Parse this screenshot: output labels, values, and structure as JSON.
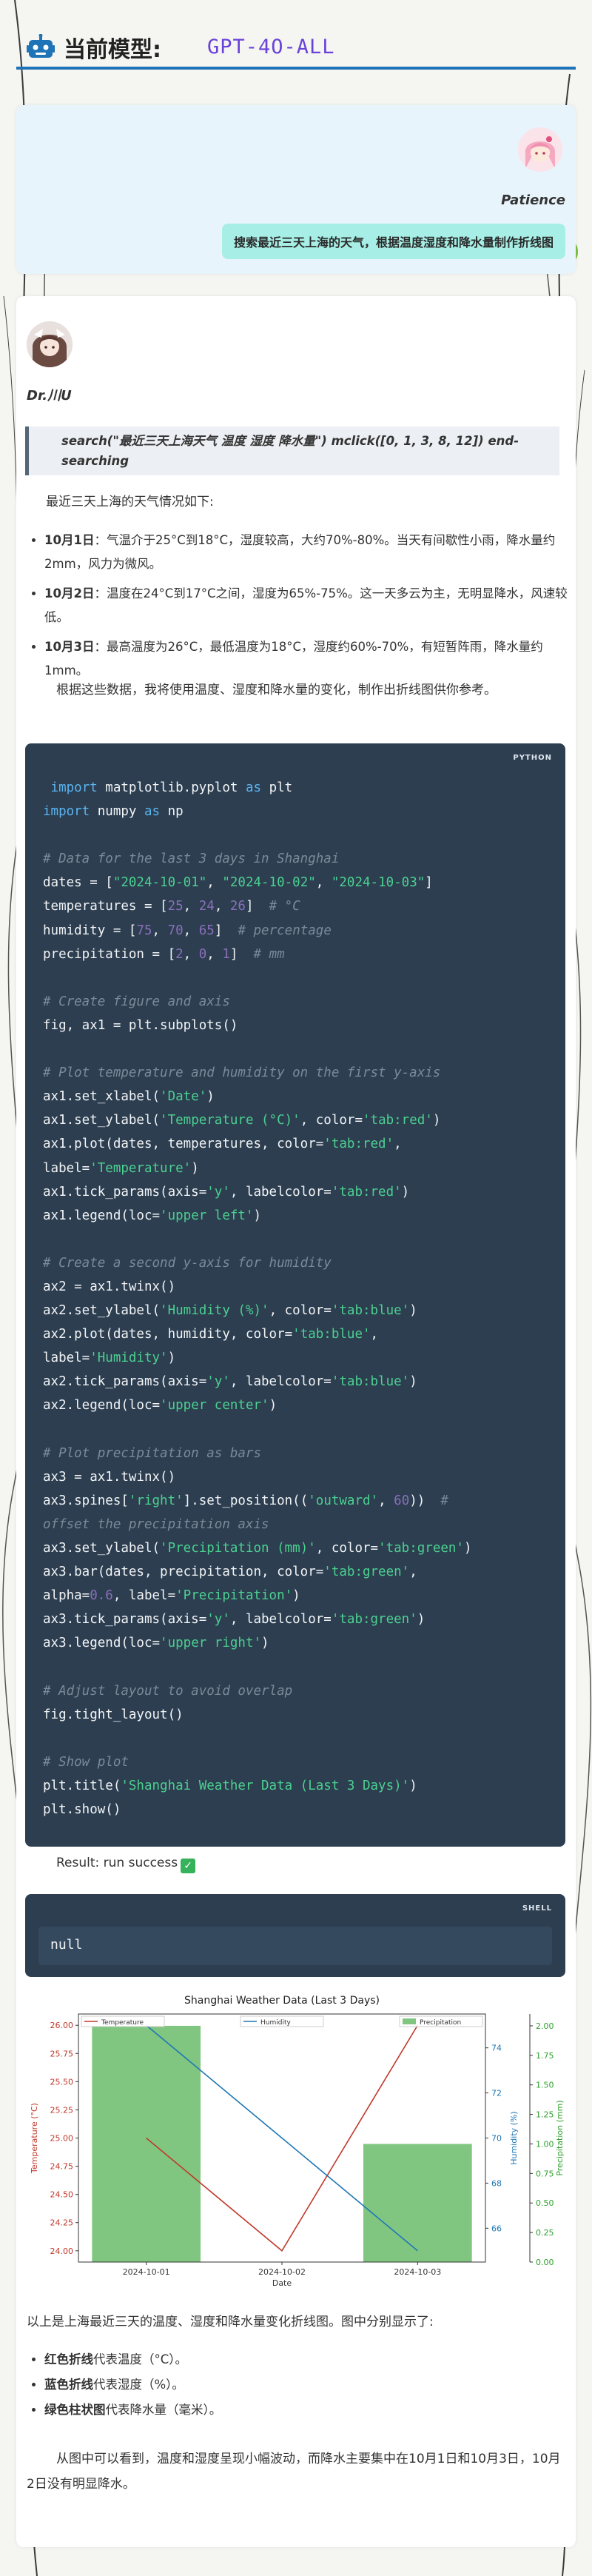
{
  "header": {
    "title": "当前模型:",
    "model": "GPT-4O-ALL"
  },
  "user": {
    "name": "Patience",
    "message": "搜索最近三天上海的天气，根据温度湿度和降水量制作折线图"
  },
  "assistant": {
    "name": "Dr.川U",
    "search_call": "search(\"最近三天上海天气 温度 湿度 降水量\") mclick([0, 1, 3, 8, 12]) end-searching",
    "intro": "最近三天上海的天气情况如下:",
    "days": [
      {
        "label": "10月1日",
        "text": "：气温介于25°C到18°C，湿度较高，大约70%-80%。当天有间歇性小雨，降水量约2mm，风力为微风。"
      },
      {
        "label": "10月2日",
        "text": "：温度在24°C到17°C之间，湿度为65%-75%。这一天多云为主，无明显降水，风速较低。"
      },
      {
        "label": "10月3日",
        "text": "：最高温度为26°C，最低温度为18°C，湿度约60%-70%，有短暂阵雨，降水量约1mm。"
      }
    ],
    "plan": "根据这些数据，我将使用温度、湿度和降水量的变化，制作出折线图供你参考。",
    "code_lang": "PYTHON",
    "result_label": "Result: run success",
    "output_lang": "SHELL",
    "output": "null",
    "summary": "以上是上海最近三天的温度、湿度和降水量变化折线图。图中分别显示了:",
    "legend_notes": [
      {
        "label": "红色折线",
        "text": "代表温度（°C）。"
      },
      {
        "label": "蓝色折线",
        "text": "代表湿度（%）。"
      },
      {
        "label": "绿色柱状图",
        "text": "代表降水量（毫米）。"
      }
    ],
    "closing": "从图中可以看到，温度和湿度呈现小幅波动，而降水主要集中在10月1日和10月3日，10月2日没有明显降水。"
  },
  "chart_data": {
    "type": "line",
    "title": "Shanghai Weather Data (Last 3 Days)",
    "categories": [
      "2024-10-01",
      "2024-10-02",
      "2024-10-03"
    ],
    "xlabel": "Date",
    "series": [
      {
        "name": "Temperature",
        "axis": "Temperature (°C)",
        "type": "line",
        "color": "#c0392b",
        "values": [
          25,
          24,
          26
        ]
      },
      {
        "name": "Humidity",
        "axis": "Humidity (%)",
        "type": "line",
        "color": "#1f77b4",
        "values": [
          75,
          70,
          65
        ]
      },
      {
        "name": "Precipitation",
        "axis": "Precipitation (mm)",
        "type": "bar",
        "color": "#2ca02c",
        "values": [
          2,
          0,
          1
        ]
      }
    ],
    "axes": {
      "temperature": {
        "label": "Temperature (°C)",
        "ylim": [
          23.9,
          26.1
        ],
        "ticks": [
          "24.00",
          "24.25",
          "24.50",
          "24.75",
          "25.00",
          "25.25",
          "25.50",
          "25.75",
          "26.00"
        ]
      },
      "humidity": {
        "label": "Humidity (%)",
        "ylim": [
          64.5,
          75.5
        ],
        "ticks": [
          "66",
          "68",
          "70",
          "72",
          "74"
        ]
      },
      "precipitation": {
        "label": "Precipitation (mm)",
        "ylim": [
          0,
          2.1
        ],
        "ticks": [
          "0.00",
          "0.25",
          "0.50",
          "0.75",
          "1.00",
          "1.25",
          "1.50",
          "1.75",
          "2.00"
        ]
      }
    },
    "legends": {
      "temperature": "upper left",
      "humidity": "upper center",
      "precipitation": "upper right"
    },
    "grid": false
  },
  "colors": {
    "accent": "#1f73b7",
    "model": "#6a42d8",
    "user_bubble": "#a7efe6",
    "code_bg": "#2c3e50"
  }
}
